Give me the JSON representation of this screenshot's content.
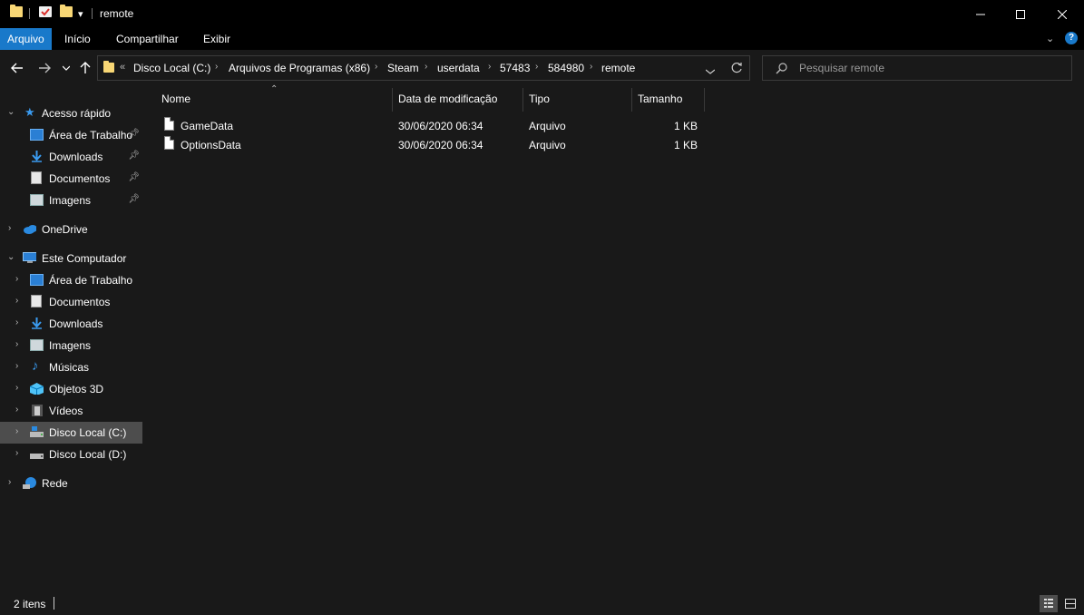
{
  "window": {
    "title": "remote",
    "qat_dropdown": "▾"
  },
  "ribbon": {
    "tabs": [
      "Arquivo",
      "Início",
      "Compartilhar",
      "Exibir"
    ],
    "active": "Arquivo",
    "help": "?"
  },
  "address": {
    "overflow": "«",
    "crumbs": [
      "Disco Local (C:)",
      "Arquivos de Programas (x86)",
      "Steam",
      "userdata",
      "57483",
      "584980",
      "remote"
    ]
  },
  "search": {
    "placeholder": "Pesquisar remote"
  },
  "nav": {
    "quick_access": {
      "label": "Acesso rápido",
      "items": [
        "Área de Trabalho",
        "Downloads",
        "Documentos",
        "Imagens"
      ]
    },
    "onedrive": "OneDrive",
    "this_pc": {
      "label": "Este Computador",
      "items": [
        "Área de Trabalho",
        "Documentos",
        "Downloads",
        "Imagens",
        "Músicas",
        "Objetos 3D",
        "Vídeos",
        "Disco Local (C:)",
        "Disco Local (D:)"
      ],
      "selected": "Disco Local (C:)"
    },
    "network": "Rede"
  },
  "columns": {
    "name": "Nome",
    "modified": "Data de modificação",
    "type": "Tipo",
    "size": "Tamanho"
  },
  "files": [
    {
      "name": "GameData",
      "modified": "30/06/2020 06:34",
      "type": "Arquivo",
      "size": "1 KB"
    },
    {
      "name": "OptionsData",
      "modified": "30/06/2020 06:34",
      "type": "Arquivo",
      "size": "1 KB"
    }
  ],
  "status": {
    "item_count": "2 itens"
  },
  "colors": {
    "accent": "#1979ca",
    "folder": "#f8d775",
    "background": "#191919",
    "selected": "#4d4d4d"
  }
}
